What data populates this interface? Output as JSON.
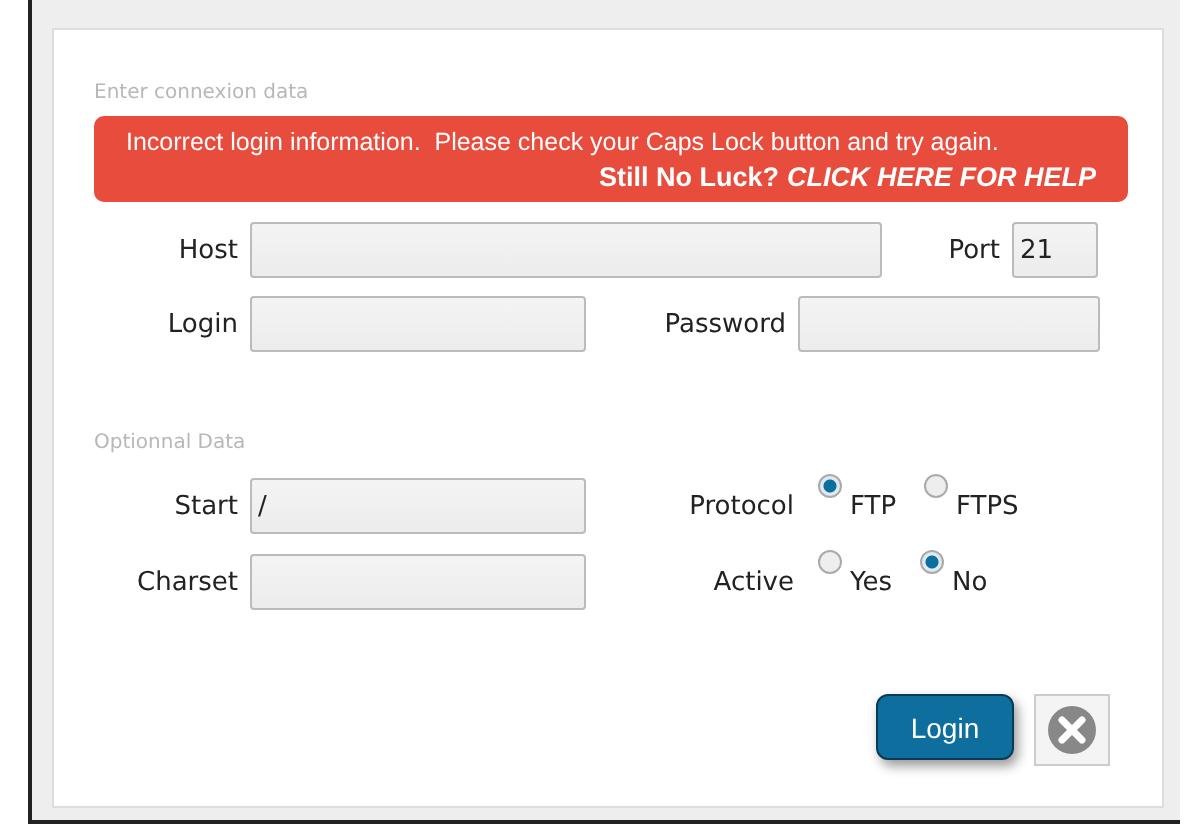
{
  "connection": {
    "legend": "Enter connexion data",
    "error": {
      "message": "Incorrect login information.  Please check your Caps Lock button and try again.",
      "prompt": "Still No Luck?",
      "link": "CLICK HERE FOR HELP"
    },
    "host": {
      "label": "Host"
    },
    "port": {
      "label": "Port",
      "value": "21"
    },
    "login": {
      "label": "Login"
    },
    "password": {
      "label": "Password"
    }
  },
  "optional": {
    "legend": "Optionnal Data",
    "start": {
      "label": "Start",
      "value": "/"
    },
    "charset": {
      "label": "Charset"
    },
    "protocol": {
      "label": "Protocol",
      "options": [
        {
          "label": "FTP",
          "selected": true
        },
        {
          "label": "FTPS",
          "selected": false
        }
      ]
    },
    "active": {
      "label": "Active",
      "options": [
        {
          "label": "Yes",
          "selected": false
        },
        {
          "label": "No",
          "selected": true
        }
      ]
    }
  },
  "buttons": {
    "login": "Login"
  }
}
